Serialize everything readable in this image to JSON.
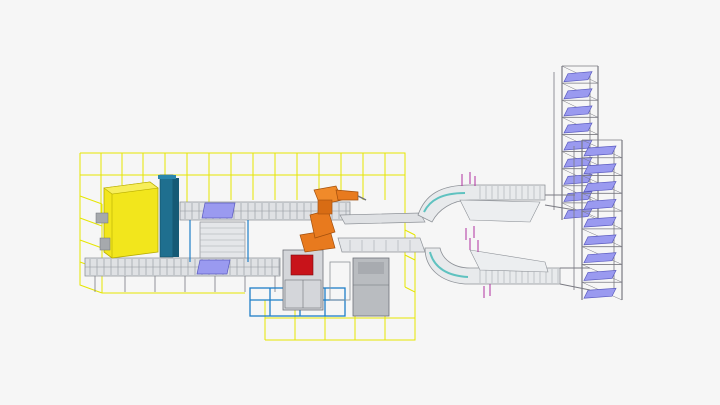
{
  "view": {
    "background": "#f6f6f6"
  },
  "colors": {
    "safety_fence": "#e6e600",
    "yellow_cabinet": "#f2e61c",
    "teal_column": "#1f6f8f",
    "robot": "#e87a1e",
    "red_panel": "#c8131a",
    "blue_accent": "#1e7fc8",
    "lavender_tray": "#9a9af0",
    "frame_grey": "#7a7a82",
    "conveyor_light": "#d7d9dc",
    "conveyor_dark": "#8e9298",
    "teal_belt": "#5fc2c0",
    "magenta_post": "#b03a8a",
    "grey_machine": "#b9bcc0"
  },
  "components": [
    {
      "name": "safety-fence-cell",
      "kind": "fence"
    },
    {
      "name": "yellow-cabinet",
      "kind": "machine"
    },
    {
      "name": "teal-column",
      "kind": "machine"
    },
    {
      "name": "industrial-robot",
      "kind": "robot"
    },
    {
      "name": "red-panel-machine",
      "kind": "machine"
    },
    {
      "name": "grey-machine",
      "kind": "machine"
    },
    {
      "name": "roller-conveyor-top",
      "kind": "conveyor"
    },
    {
      "name": "roller-conveyor-bottom",
      "kind": "conveyor"
    },
    {
      "name": "blue-base-frame",
      "kind": "frame"
    },
    {
      "name": "curved-conveyor-upper",
      "kind": "conveyor"
    },
    {
      "name": "curved-conveyor-lower",
      "kind": "conveyor"
    },
    {
      "name": "spiral-lift-tower-left",
      "kind": "tower"
    },
    {
      "name": "spiral-lift-tower-right",
      "kind": "tower"
    }
  ]
}
